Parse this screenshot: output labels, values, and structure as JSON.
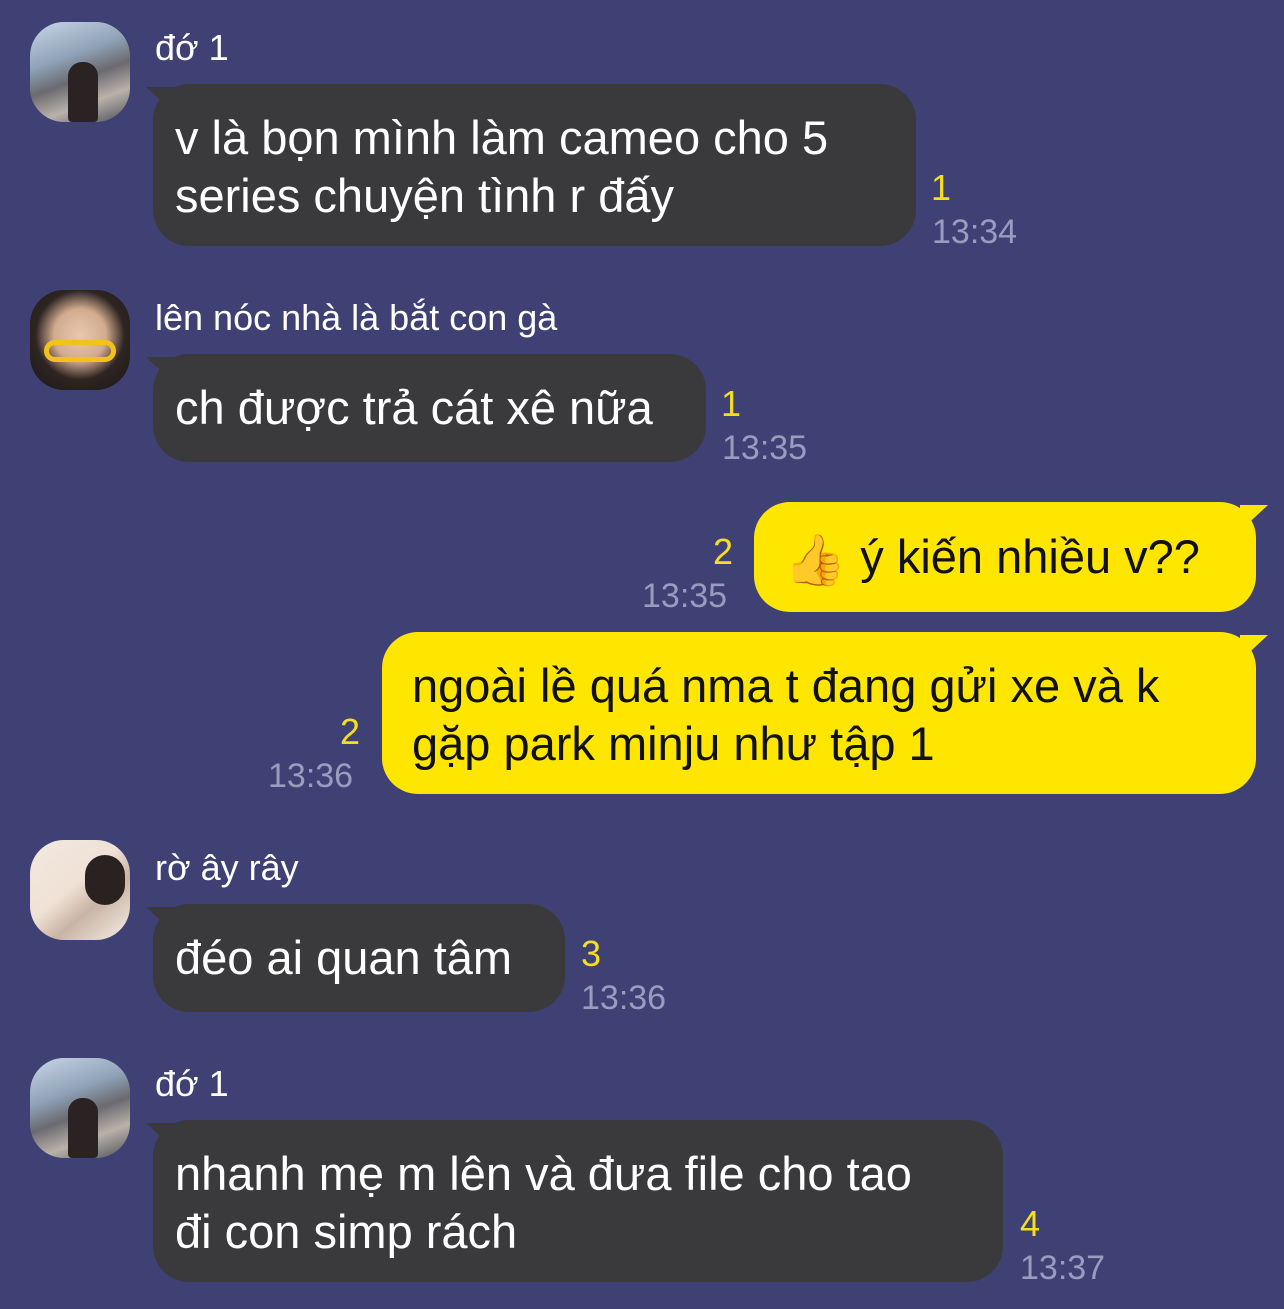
{
  "messages": [
    {
      "sender": "đớ 1",
      "lines": [
        "v là bọn mình làm cameo cho 5",
        "series chuyện tình r đấy"
      ],
      "unread": "1",
      "time": "13:34"
    },
    {
      "sender": "lên nóc nhà là bắt con gà",
      "lines": [
        "ch được trả cát xê nữa"
      ],
      "unread": "1",
      "time": "13:35"
    },
    {
      "emoji": "👍",
      "lines": [
        "ý kiến nhiều v??"
      ],
      "unread": "2",
      "time": "13:35"
    },
    {
      "lines": [
        "ngoài lề quá nma t đang gửi xe và k",
        "gặp park minju như tập 1"
      ],
      "unread": "2",
      "time": "13:36"
    },
    {
      "sender": "rờ ây rây",
      "lines": [
        "đéo ai quan tâm"
      ],
      "unread": "3",
      "time": "13:36"
    },
    {
      "sender": "đớ 1",
      "lines": [
        "nhanh mẹ m lên và đưa file cho tao",
        "đi con simp rách"
      ],
      "unread": "4",
      "time": "13:37"
    }
  ]
}
